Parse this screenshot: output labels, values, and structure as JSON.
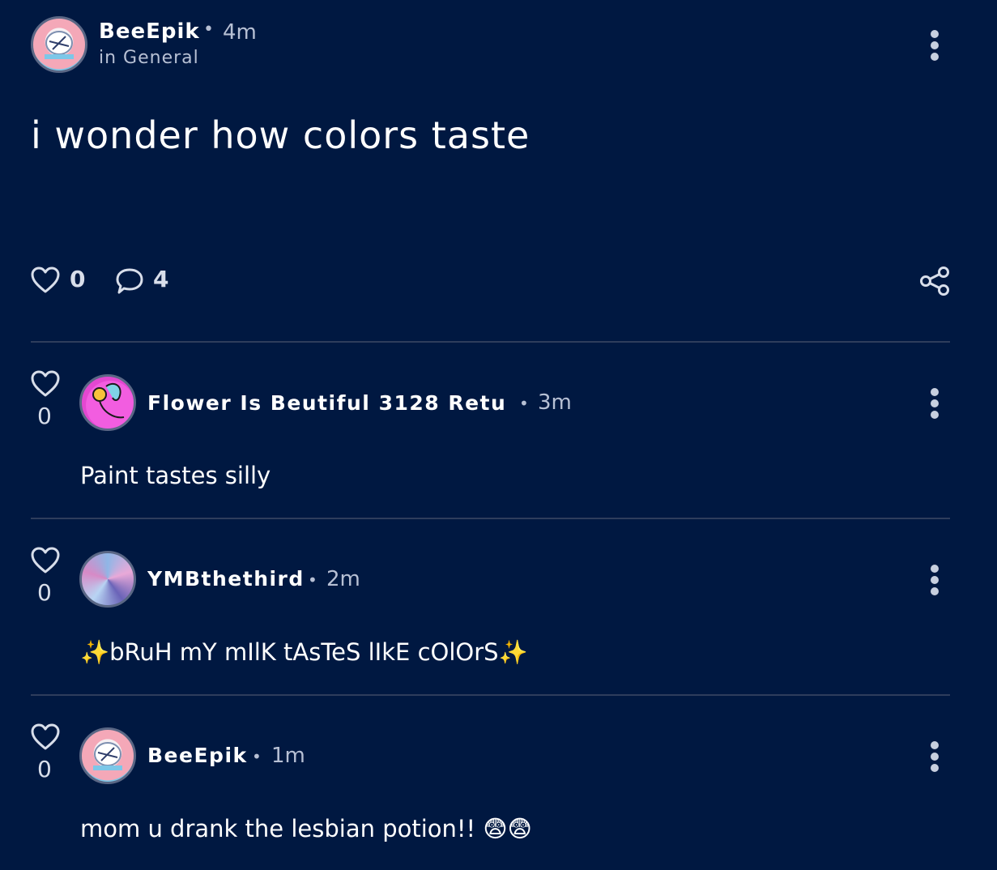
{
  "post": {
    "author": "BeeEpik",
    "time": "4m",
    "category": "in General",
    "body": "i wonder how colors taste",
    "likes": "0",
    "comments": "4",
    "icons": {
      "like": "heart-icon",
      "comment": "speech-bubble-icon",
      "share": "share-icon",
      "menu": "kebab-menu-icon"
    }
  },
  "comments": [
    {
      "author": "Flower Is Beutiful 3128 Retu…",
      "time": "3m",
      "likes": "0",
      "body": "Paint tastes silly"
    },
    {
      "author": "YMBthethird",
      "time": "2m",
      "likes": "0",
      "body": "✨bRuH mY mIlK tAsTeS lIkE cOlOrS✨"
    },
    {
      "author": "BeeEpik",
      "time": "1m",
      "likes": "0",
      "body": "mom u drank the lesbian potion!! 😨😨"
    }
  ],
  "separator": "•",
  "colors": {
    "background": "#001841",
    "divider": "#2e3d5c",
    "muted_text": "#b7c0d4"
  }
}
